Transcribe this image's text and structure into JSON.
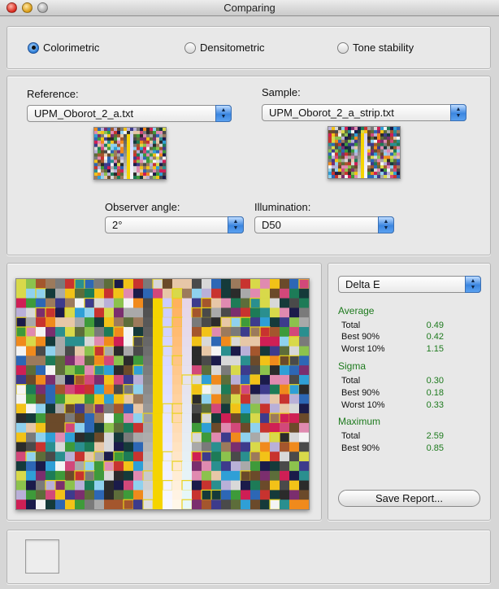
{
  "window": {
    "title": "Comparing"
  },
  "mode": {
    "options": [
      "Colorimetric",
      "Densitometric",
      "Tone stability"
    ],
    "selected": "Colorimetric"
  },
  "reference": {
    "label": "Reference:",
    "file": "UPM_Oborot_2_a.txt"
  },
  "sample": {
    "label": "Sample:",
    "file": "UPM_Oborot_2_a_strip.txt"
  },
  "observer": {
    "label": "Observer angle:",
    "value": "2°"
  },
  "illumination": {
    "label": "Illumination:",
    "value": "D50"
  },
  "metric": {
    "value": "Delta E"
  },
  "stats": {
    "average": {
      "heading": "Average",
      "rows": [
        {
          "name": "Total",
          "value": "0.49"
        },
        {
          "name": "Best 90%",
          "value": "0.42"
        },
        {
          "name": "Worst 10%",
          "value": "1.15"
        }
      ]
    },
    "sigma": {
      "heading": "Sigma",
      "rows": [
        {
          "name": "Total",
          "value": "0.30"
        },
        {
          "name": "Best 90%",
          "value": "0.18"
        },
        {
          "name": "Worst 10%",
          "value": "0.33"
        }
      ]
    },
    "maximum": {
      "heading": "Maximum",
      "rows": [
        {
          "name": "Total",
          "value": "2.59"
        },
        {
          "name": "Best 90%",
          "value": "0.85"
        }
      ]
    }
  },
  "save_report": {
    "label": "Save Report..."
  },
  "colors": {
    "stat_value": "#1d7a1d",
    "highlight_outline": "#e8d21a",
    "accent": "#3b86e0"
  },
  "icons": {
    "radio_selected": "radio-selected-icon",
    "popup_arrows": "popup-arrows-icon"
  }
}
